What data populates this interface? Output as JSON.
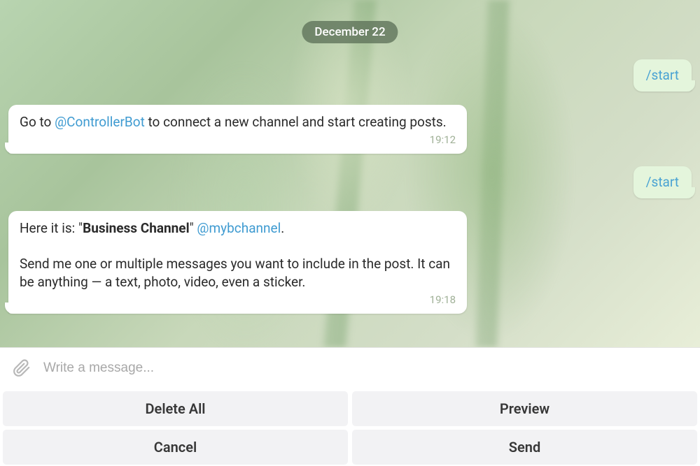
{
  "dateLabel": "December 22",
  "messages": {
    "out1": {
      "text": "/start"
    },
    "in1": {
      "prefix": "Go to ",
      "mention": "@ControllerBot",
      "suffix": " to connect a new channel and start creating posts.",
      "time": "19:12"
    },
    "out2": {
      "text": "/start"
    },
    "in2": {
      "line1_prefix": "Here it is: \"",
      "line1_bold": "Business Channel",
      "line1_mid": "\" ",
      "line1_mention": "@mybchannel",
      "line1_suffix": ".",
      "line2": "Send me one or multiple messages you want to include in the post. It can be anything — a text, photo, video, even a sticker.",
      "time": "19:18"
    }
  },
  "input": {
    "placeholder": "Write a message..."
  },
  "keyboard": {
    "deleteAll": "Delete All",
    "preview": "Preview",
    "cancel": "Cancel",
    "send": "Send"
  }
}
